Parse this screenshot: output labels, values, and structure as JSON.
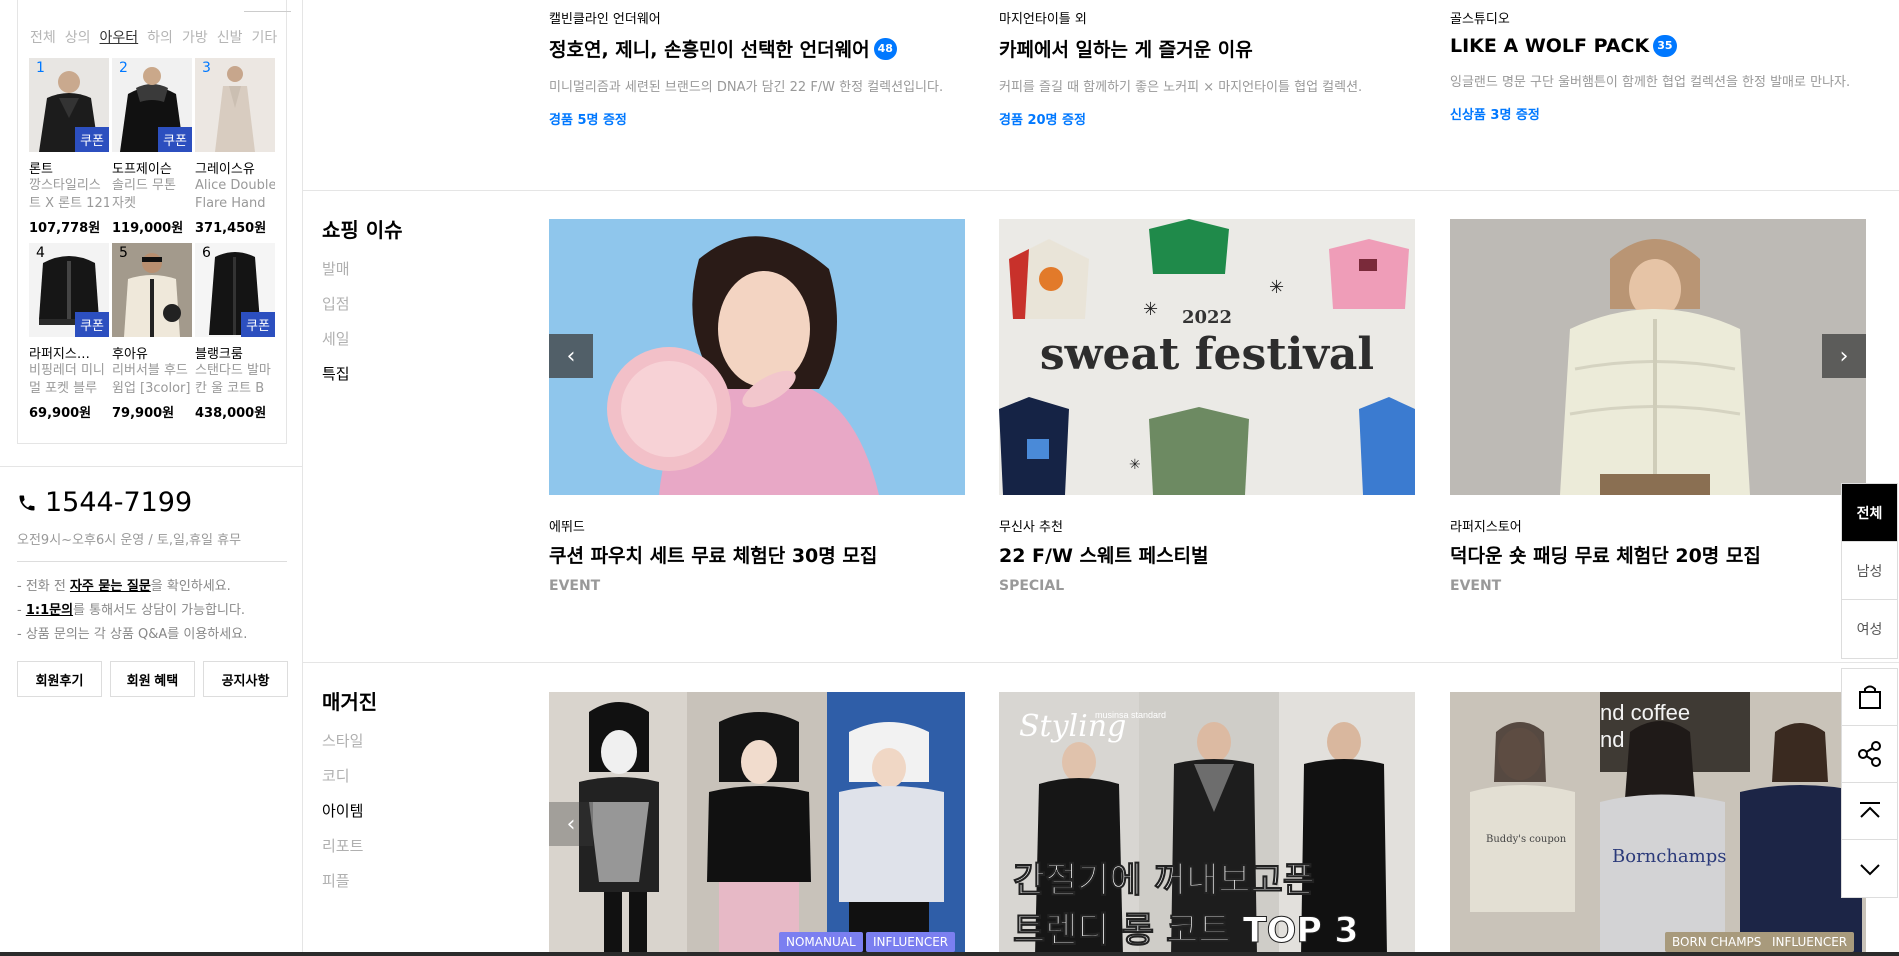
{
  "ranking": {
    "tabs": [
      "전체",
      "상의",
      "아우터",
      "하의",
      "가방",
      "신발",
      "기타"
    ],
    "active_tab": "아우터",
    "coupon_label": "쿠폰",
    "items": [
      {
        "rank": "1",
        "brand": "론트",
        "name_line1": "깡스타일리스",
        "name_line2": "트 X 론트 121",
        "price": "107,778원",
        "coupon": true
      },
      {
        "rank": "2",
        "brand": "도프제이슨",
        "name_line1": "솔리드 무톤",
        "name_line2": "자켓",
        "price": "119,000원",
        "coupon": true
      },
      {
        "rank": "3",
        "brand": "그레이스유",
        "name_line1": "Alice Double",
        "name_line2": "Flare Hand",
        "price": "371,450원",
        "coupon": false
      },
      {
        "rank": "4",
        "brand": "라퍼지스…",
        "name_line1": "비핑레더 미니",
        "name_line2": "멀 포켓 블루",
        "price": "69,900원",
        "coupon": true
      },
      {
        "rank": "5",
        "brand": "후아유",
        "name_line1": "리버서블 후드",
        "name_line2": "윔업 [3color]",
        "price": "79,900원",
        "coupon": false
      },
      {
        "rank": "6",
        "brand": "블랭크룸",
        "name_line1": "스탠다드 발마",
        "name_line2": "칸 울 코트  B",
        "price": "438,000원",
        "coupon": true
      }
    ]
  },
  "customer_service": {
    "phone": "1544-7199",
    "hours": "오전9시~오후6시 운영 / 토,일,휴일 휴무",
    "note1_pre": "- 전화 전 ",
    "note1_link": "자주 묻는 질문",
    "note1_post": "을 확인하세요.",
    "note2_pre": "- ",
    "note2_link": "1:1문의",
    "note2_post": "를 통해서도 상담이 가능합니다.",
    "note3": "- 상품 문의는 각 상품 Q&A를 이용하세요.",
    "buttons": [
      "회원후기",
      "회원 혜택",
      "공지사항"
    ]
  },
  "promos": [
    {
      "brand": "캘빈클라인 언더웨어",
      "title": "정호연, 제니, 손흥민이 선택한 언더웨어",
      "badge": "48",
      "desc": "미니멀리즘과 세련된 브랜드의 DNA가 담긴 22 F/W 한정 컬렉션입니다.",
      "gift": "경품 5명 증정"
    },
    {
      "brand": "마지언타이틀 외",
      "title": "카페에서 일하는 게 즐거운 이유",
      "badge": "",
      "desc": "커피를 즐길 때 함께하기 좋은 노커피 × 마지언타이틀 협업 컬렉션.",
      "gift": "경품 20명 증정"
    },
    {
      "brand": "골스튜디오",
      "title": "LIKE A WOLF PACK",
      "badge": "35",
      "desc": "잉글랜드 명문 구단 울버햄튼이 함께한 협업 컬렉션을 한정 발매로 만나자.",
      "gift": "신상품 3명 증정"
    }
  ],
  "shopping_issue": {
    "title": "쇼핑 이슈",
    "categories": [
      "발매",
      "입점",
      "세일",
      "특집"
    ],
    "active": "특집",
    "cards": [
      {
        "brand": "에뛰드",
        "title": "쿠션 파우치 세트 무료 체험단 30명 모집",
        "type": "EVENT"
      },
      {
        "brand": "무신사 추천",
        "title": "22 F/W 스웨트 페스티벌",
        "type": "SPECIAL",
        "img_text_year": "2022",
        "img_text_main": "sweat festival"
      },
      {
        "brand": "라퍼지스토어",
        "title": "덕다운 숏 패딩 무료 체험단 20명 모집",
        "type": "EVENT"
      }
    ]
  },
  "magazine": {
    "title": "매거진",
    "categories": [
      "스타일",
      "코디",
      "아이템",
      "리포트",
      "피플"
    ],
    "active": "아이템",
    "cards": [
      {
        "tags": [
          "NOMANUAL",
          "INFLUENCER"
        ]
      },
      {
        "img_line1": "간절기에 꺼내보고픈",
        "img_line2": "트렌디 롱 코트 TOP 3",
        "img_script": "Styling",
        "img_small": "musinsa standard"
      },
      {
        "tags": [
          "BORN CHAMPS",
          "INFLUENCER"
        ],
        "img_text1": "nd coffee",
        "img_text2": "nd coffe",
        "sweat1": "Buddy's coupon",
        "sweat2": "Bornchamps"
      }
    ]
  },
  "right_rail": {
    "genders": [
      "전체",
      "남성",
      "여성"
    ],
    "active": "전체",
    "tools": [
      "bag-icon",
      "share-icon",
      "scroll-top-icon",
      "scroll-down-icon"
    ]
  },
  "colors": {
    "accent": "#0078ff",
    "coupon": "#2c4fbf",
    "tag_purple": "#7b7ff0",
    "tag_tan": "#a89a7c"
  }
}
